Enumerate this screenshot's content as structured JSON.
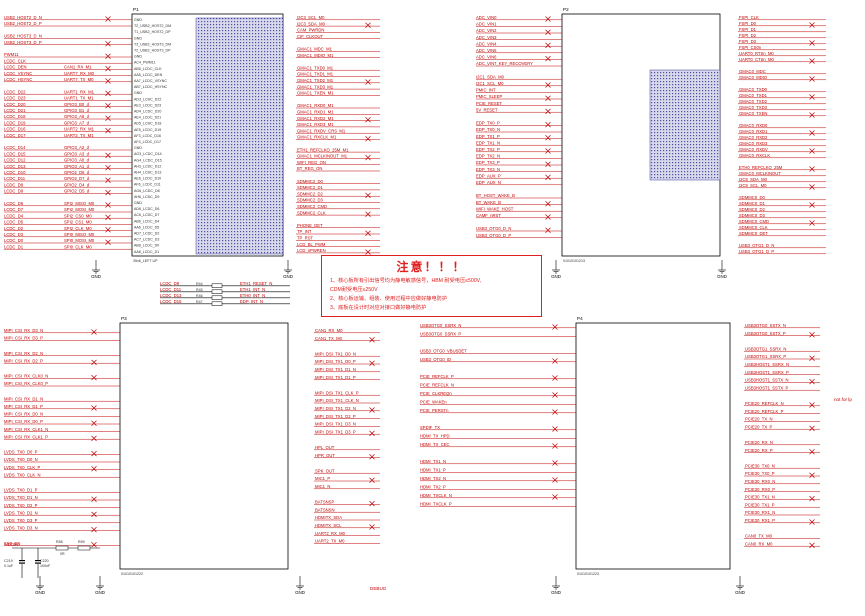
{
  "refs": {
    "p1": "P1",
    "p2": "P2",
    "p3": "P3",
    "p4": "P4"
  },
  "footers": {
    "p1": "35x6_LEFT UP",
    "p2": "01010101213",
    "p3": "01010101222",
    "p4": "01010101223"
  },
  "gnd": "GND",
  "note": {
    "title": "注意！！！",
    "line1": "1、核心板所有引出信号均为静电敏感信号，HBM 耐受电压≤500V,",
    "line2": "CDM耐受电压≤250V",
    "line3": "2、核心板运输、组装、使用过程中应做好静电防护",
    "line4": "3、底板在设计时对应对接口做好静电防护"
  },
  "debug": "DEBUG",
  "notlp": "not for lp",
  "p1_left": [
    "USB2_HOST2_D_N",
    "USB2_HOST2_D_P",
    "",
    "USB2_HOST3_D_N",
    "USB2_HOST3_D_P",
    "",
    "PWM11",
    "LCDC_CLK",
    "LCDC_DEN",
    "LCDC_VSYNC",
    "LCDC_HSYNC",
    "",
    "LCDC_D22",
    "LCDC_D23",
    "LCDC_D20",
    "LCDC_D21",
    "LCDC_D18",
    "LCDC_D19",
    "LCDC_D16",
    "LCDC_D17",
    "",
    "LCDC_D14",
    "LCDC_D15",
    "LCDC_D12",
    "LCDC_D13",
    "LCDC_D10",
    "LCDC_D11",
    "LCDC_D8",
    "LCDC_D9",
    "",
    "LCDC_D6",
    "LCDC_D7",
    "LCDC_D4",
    "LCDC_D5",
    "LCDC_D2",
    "LCDC_D3",
    "LCDC_D0",
    "LCDC_D1"
  ],
  "p1_left_alt": [
    "",
    "",
    "",
    "",
    "",
    "",
    "",
    "",
    "CAN1_RX_M1",
    "UART7_RX_M0",
    "UART7_TX_M0",
    "",
    "UART1_RX_M1",
    "UART1_TX_M1",
    "GPIO3_B0_d",
    "GPIO3_B1_d",
    "GPIO3_A6_d",
    "GPIO3_A7_d",
    "UART2_RX_M1",
    "UART2_TX_M1",
    "",
    "GPIO3_A2_d",
    "GPIO3_A3_d",
    "GPIO3_A0_d",
    "GPIO3_A1_d",
    "GPIO2_D6_d",
    "GPIO2_D7_d",
    "GPIO2_D4_d",
    "GPIO2_D5_d",
    "",
    "SPI2_MISO_M0",
    "SPI2_MOSI_M0",
    "SPI2_CS0_M0",
    "SPI2_CS1_M0",
    "SPI2_CLK_M0",
    "SPI0_MISO_M0",
    "SPI0_MOSI_M0",
    "SPI0_CLK_M0"
  ],
  "p1_inner": [
    "GND",
    "T2_USB2_HOST2_DM",
    "T1_USB2_HOST2_DP",
    "GND",
    "T3_USB2_HOST3_DM",
    "T2_USB2_HOST3_DP",
    "GND",
    "AC4_PWM11",
    "AB5_LCDC_CLK",
    "AA5_LCDC_DEN",
    "AA7_LCDC_VSYNC",
    "AB7_LCDC_HSYNC",
    "GND",
    "AD3_LCDC_D22",
    "AE3_LCDC_D23",
    "AD4_LCDC_D20",
    "AE4_LCDC_D21",
    "AD5_LCDC_D18",
    "AE5_LCDC_D19",
    "AF3_LCDC_D16",
    "AF4_LCDC_D17",
    "GND",
    "AG3_LCDC_D14",
    "AG4_LCDC_D15",
    "AH3_LCDC_D12",
    "AH4_LCDC_D13",
    "AE6_LCDC_D10",
    "AF6_LCDC_D11",
    "AG6_LCDC_D8",
    "AH6_LCDC_D9",
    "GND",
    "AD6_LCDC_D6",
    "AC6_LCDC_D7",
    "AB6_LCDC_D4",
    "AA6_LCDC_D5",
    "AD7_LCDC_D2",
    "AC7_LCDC_D3",
    "AB8_LCDC_D0",
    "AA8_LCDC_D1"
  ],
  "p1_right": [
    "I2C3_SCL_M0",
    "I2C3_SDA_M0",
    "CAM_PWRDN",
    "CIF_CLKOUT",
    "",
    "GMAC1_MDC_M1",
    "GMAC1_MDIO_M1",
    "",
    "GMAC1_TXD0_M1",
    "GMAC1_TXD1_M1",
    "GMAC1_TXD2_M1",
    "GMAC1_TXD3_M1",
    "GMAC1_TXEN_M1",
    "",
    "GMAC1_RXD0_M1",
    "GMAC1_RXD1_M1",
    "GMAC1_RXD2_M1",
    "GMAC1_RXD3_M1",
    "GMAC1_RXDV_CRS_M1",
    "GMAC1_RXCLK_M1",
    "",
    "ETH1_REFCLKO_25M_M1",
    "GMAC1_MCLKINOUT_M1",
    "WIFI_REG_ON",
    "BT_REG_ON",
    "",
    "SDMMC2_D0",
    "SDMMC2_D1",
    "SDMMC2_D2",
    "SDMMC2_D3",
    "SDMMC2_CMD",
    "SDMMC2_CLK",
    "",
    "PHONE_DET",
    "TP_INT",
    "TP_RST",
    "LCD_BL_PWM",
    "LCD_nPWREN"
  ],
  "p2_left": [
    "ADC_VIN0",
    "ADC_VIN1",
    "ADC_VIN2",
    "ADC_VIN3",
    "ADC_VIN4",
    "ADC_VIN5",
    "ADC_VIN6",
    "ADC_VIN7_KEY_RECOVERY",
    "",
    "I2C1_SDA_M0",
    "I2C1_SCL_M0",
    "PMIC_INT",
    "PMIC_SLEEP",
    "PCIE_RESET",
    "5V_RESET",
    "",
    "EDP_TX0_P",
    "EDP_TX0_N",
    "EDP_TX1_P",
    "EDP_TX1_N",
    "EDP_TX2_P",
    "EDP_TX2_N",
    "EDP_TX3_P",
    "EDP_TX3_N",
    "EDP_AUX_P",
    "EDP_AUX_N",
    "",
    "BT_HOST_WAKE_B",
    "BT_WAKE_B",
    "WIFI_WAKE_HOST",
    "CAMF_nRST",
    "",
    "USB3_OTG0_D_N",
    "USB3_OTG0_D_P"
  ],
  "p2_right": [
    "FSPI_CLK",
    "FSPI_D0",
    "FSPI_D1",
    "FSPI_D2",
    "FSPI_D3",
    "FSPI_CS0n",
    "UART0_RTSn_M0",
    "UART0_CTSn_M0",
    "",
    "GMAC0_MDC",
    "GMAC0_MDIO",
    "",
    "GMAC0_TXD0",
    "GMAC0_TXD1",
    "GMAC0_TXD2",
    "GMAC0_TXD3",
    "GMAC0_TXEN",
    "",
    "GMAC0_RXD0",
    "GMAC0_RXD1",
    "GMAC0_RXD2",
    "GMAC0_RXD3",
    "GMAC0_RXDV",
    "GMAC0_RXCLK",
    "",
    "ETH0_REFCLKO_25M",
    "GMAC0_MCLKINOUT",
    "I2C5_SDA_M0",
    "I2C5_SCL_M0",
    "",
    "SDMMC0_D0",
    "SDMMC0_D1",
    "SDMMC0_D2",
    "SDMMC0_D3",
    "SDMMC0_CMD",
    "SDMMC0_CLK",
    "SDMMC0_DET",
    "",
    "USB3_OTG1_D_N",
    "USB3_OTG1_D_P"
  ],
  "p3_left": [
    "MIPI_CSI_RX_D3_N",
    "MIPI_CSI_RX_D3_P",
    "",
    "MIPI_CSI_RX_D2_N",
    "MIPI_CSI_RX_D2_P",
    "",
    "MIPI_CSI_RX_CLK0_N",
    "MIPI_CSI_RX_CLK0_P",
    "",
    "MIPI_CSI_RX_D1_N",
    "MIPI_CSI_RX_D1_P",
    "MIPI_CSI_RX_D0_N",
    "MIPI_CSI_RX_D0_P",
    "MIPI_CSI_RX_CLK1_N",
    "MIPI_CSI_RX_CLK1_P",
    "",
    "LVDS_TX0_D0_P",
    "LVDS_TX0_D0_N",
    "LVDS_TX0_CLK_P",
    "LVDS_TX0_CLK_N",
    "",
    "LVDS_TX0_D1_P",
    "LVDS_TX0_D1_N",
    "LVDS_TX0_D2_P",
    "LVDS_TX0_D2_N",
    "LVDS_TX0_D3_P",
    "LVDS_TX0_D3_N",
    "",
    "EXT_EN"
  ],
  "p3_right": [
    "CAN1_RX_M0",
    "CAN1_TX_M0",
    "",
    "MIPI_DSI_TX1_D0_N",
    "MIPI_DSI_TX1_D0_P",
    "MIPI_DSI_TX1_D1_N",
    "MIPI_DSI_TX1_D1_P",
    "",
    "MIPI_DSI_TX1_CLK_P",
    "MIPI_DSI_TX1_CLK_N",
    "MIPI_DSI_TX1_D2_N",
    "MIPI_DSI_TX1_D2_P",
    "MIPI_DSI_TX1_D3_N",
    "MIPI_DSI_TX1_D3_P",
    "",
    "HPL_OUT",
    "HPR_OUT",
    "",
    "SPK_OUT",
    "MIC1_P",
    "MIC1_N",
    "",
    "BATSNSP",
    "BATSNSN",
    "HDMITX_SDA",
    "HDMITX_SCL",
    "UART2_RX_M0",
    "UART2_TX_M0"
  ],
  "p4_left": [
    "USB3OTG0_SSRX_N",
    "USB3OTG0_SSRX_P",
    "",
    "USB3_OTG0_VBUSDET",
    "USB3_OTG0_ID",
    "",
    "PCIE_REFCLK_P",
    "PCIE_REFCLK_N",
    "PCIE_CLKREQn",
    "PCIE_WAKEn",
    "PCIE_PERSTn",
    "",
    "SPDIF_TX",
    "HDMI_TX_HPD",
    "HDMI_TX_CEC",
    "",
    "HDMI_TX1_N",
    "HDMI_TX1_P",
    "HDMI_TX2_N",
    "HDMI_TX2_P",
    "HDMI_TXCLK_N",
    "HDMI_TXCLK_P"
  ],
  "p4_right": [
    "USB3OTG0_SSTX_N",
    "USB3OTG0_SSTX_P",
    "",
    "USB3OTG1_SSRX_N",
    "USB3OTG1_SSRX_P",
    "USB3HOST1_SSRX_N",
    "USB3HOST1_SSRX_P",
    "USB3HOST1_SSTX_N",
    "USB3HOST1_SSTX_P",
    "",
    "PCIE20_REFCLK_N",
    "PCIE20_REFCLK_P",
    "PCIE20_TX_N",
    "PCIE20_TX_P",
    "",
    "PCIE20_RX_N",
    "PCIE20_RX_P",
    "",
    "PCIE30_TX0_N",
    "PCIE30_TX0_P",
    "PCIE30_RX0_N",
    "PCIE30_RX0_P",
    "PCIE30_TX1_N",
    "PCIE30_TX1_P",
    "PCIE30_RX1_N",
    "PCIE30_RX1_P",
    "",
    "CAN0_TX_M0",
    "CAN0_RX_M0"
  ],
  "mid_nets": [
    "LCDC_D9",
    "LCDC_D11",
    "LCDC_D13",
    "LCDC_D15"
  ],
  "mid_res": [
    "R44",
    "R45",
    "R46",
    "R47"
  ],
  "mid_out": [
    "ETH1_RESET_N",
    "ETH1_INT_N",
    "ETH0_INT_N",
    "EDP_INT_N"
  ],
  "pwr": {
    "vdd": "VDD5V",
    "c1": "C219",
    "c2": "C220",
    "r1": "R58",
    "r2": "R59",
    "v1": "0.1uF",
    "v2": "100nF",
    "rv": "0R"
  }
}
